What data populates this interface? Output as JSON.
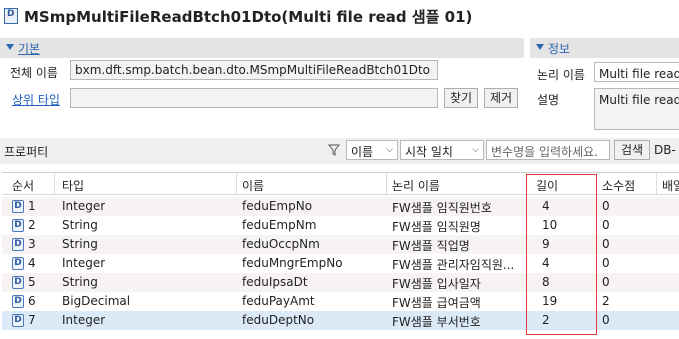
{
  "title": "MSmpMultiFileReadBtch01Dto(Multi file read 샘플 01)",
  "title_icon": "D",
  "basic_section": {
    "header": "기본",
    "full_name_label": "전체 이름",
    "full_name_value": "bxm.dft.smp.batch.bean.dto.MSmpMultiFileReadBtch01Dto",
    "parent_type_label": "상위 타입",
    "parent_type_value": "",
    "find_button": "찾기",
    "remove_button": "제거"
  },
  "info_section": {
    "header": "정보",
    "logical_name_label": "논리 이름",
    "logical_name_value": "Multi file read 샘",
    "description_label": "설명",
    "description_value": "Multi file read 샘"
  },
  "properties": {
    "title": "프로퍼티",
    "filter_field_selected": "이름",
    "match_mode_selected": "시작 일치",
    "search_placeholder": "변수명을 입력하세요.",
    "search_button": "검색",
    "db_button": "DB-"
  },
  "table": {
    "columns": [
      "순서",
      "타입",
      "이름",
      "논리 이름",
      "길이",
      "소수점",
      "배열"
    ],
    "rows": [
      {
        "order": "1",
        "type": "Integer",
        "name": "feduEmpNo",
        "logical": "FW샘플 임직원번호",
        "length": "4",
        "decimal": "0"
      },
      {
        "order": "2",
        "type": "String",
        "name": "feduEmpNm",
        "logical": "FW샘플 임직원명",
        "length": "10",
        "decimal": "0"
      },
      {
        "order": "3",
        "type": "String",
        "name": "feduOccpNm",
        "logical": "FW샘플 직업명",
        "length": "9",
        "decimal": "0"
      },
      {
        "order": "4",
        "type": "Integer",
        "name": "feduMngrEmpNo",
        "logical": "FW샘플 관리자임직원...",
        "length": "4",
        "decimal": "0"
      },
      {
        "order": "5",
        "type": "String",
        "name": "feduIpsaDt",
        "logical": "FW샘플 입사일자",
        "length": "8",
        "decimal": "0"
      },
      {
        "order": "6",
        "type": "BigDecimal",
        "name": "feduPayAmt",
        "logical": "FW샘플 급여금액",
        "length": "19",
        "decimal": "2"
      },
      {
        "order": "7",
        "type": "Integer",
        "name": "feduDeptNo",
        "logical": "FW샘플 부서번호",
        "length": "2",
        "decimal": "0"
      }
    ]
  },
  "colors": {
    "accent": "#2c67b0",
    "highlight_box": "#e03c3c",
    "selected_row": "#dce9f7"
  }
}
